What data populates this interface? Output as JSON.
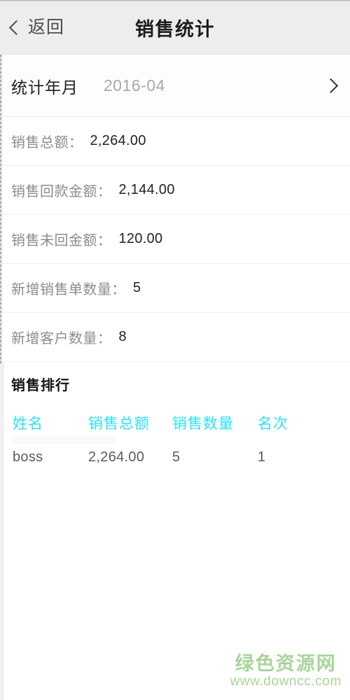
{
  "titlebar": {
    "back_label": "返回",
    "back_icon": "chevron-left-icon",
    "title": "销售统计"
  },
  "selector": {
    "label": "统计年月",
    "value": "2016-04",
    "chevron_icon": "chevron-right-icon"
  },
  "stats": {
    "rows": [
      {
        "label": "销售总额：",
        "value": "2,264.00"
      },
      {
        "label": "销售回款金额：",
        "value": "2,144.00"
      },
      {
        "label": "销售未回金额：",
        "value": "120.00"
      },
      {
        "label": "新增销售单数量：",
        "value": "5"
      },
      {
        "label": "新增客户数量：",
        "value": "8"
      }
    ]
  },
  "ranking": {
    "title": "销售排行",
    "columns": [
      "姓名",
      "销售总额",
      "销售数量",
      "名次"
    ],
    "rows": [
      {
        "name": "boss",
        "total": "2,264.00",
        "count": "5",
        "rank": "1"
      }
    ]
  },
  "watermark": {
    "main": "绿色资源网",
    "sub": "www.downcc.com"
  },
  "artifacts": {
    "ghost_text": "销售总额：   2,264.00"
  },
  "colors": {
    "titlebar_bg": "#ededed",
    "accent_cyan": "#2ce2f5",
    "label_gray": "#8c8c8c",
    "value_dark": "#222222",
    "value_gray": "#5a5a5a",
    "placeholder_gray": "#a8a8a8",
    "watermark_green": "#a8d59a",
    "page_bg": "#ffffff",
    "divider": "#f0f0f0"
  }
}
